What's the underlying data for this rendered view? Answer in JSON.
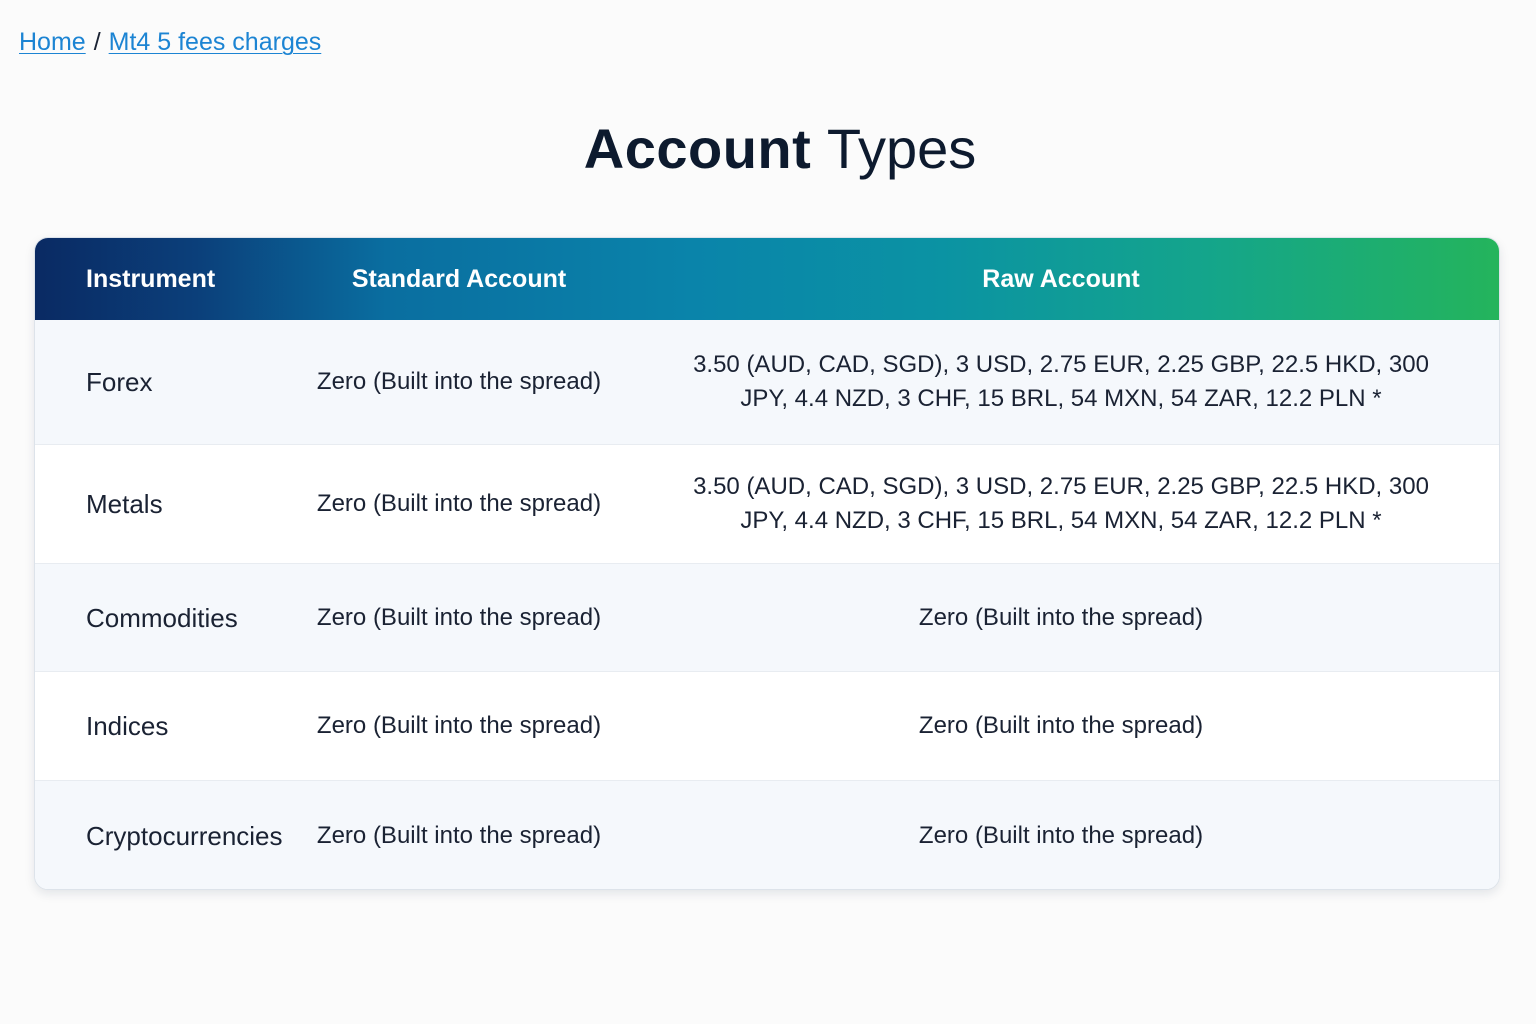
{
  "breadcrumb": {
    "home": "Home",
    "separator": "/",
    "current": "Mt4 5 fees charges"
  },
  "page": {
    "title_strong": "Account",
    "title_light": "Types"
  },
  "table": {
    "headers": [
      "Instrument",
      "Standard Account",
      "Raw Account"
    ],
    "rows": [
      {
        "instrument": "Forex",
        "standard": "Zero (Built into the spread)",
        "raw": "3.50 (AUD, CAD, SGD), 3 USD, 2.75 EUR, 2.25 GBP, 22.5 HKD, 300 JPY, 4.4 NZD, 3 CHF, 15 BRL, 54 MXN, 54 ZAR, 12.2 PLN *"
      },
      {
        "instrument": "Metals",
        "standard": "Zero (Built into the spread)",
        "raw": "3.50 (AUD, CAD, SGD), 3 USD, 2.75 EUR, 2.25 GBP, 22.5 HKD, 300 JPY, 4.4 NZD, 3 CHF, 15 BRL, 54 MXN, 54 ZAR, 12.2 PLN *"
      },
      {
        "instrument": "Commodities",
        "standard": "Zero (Built into the spread)",
        "raw": "Zero (Built into the spread)"
      },
      {
        "instrument": "Indices",
        "standard": "Zero (Built into the spread)",
        "raw": "Zero (Built into the spread)"
      },
      {
        "instrument": "Cryptocurrencies",
        "standard": "Zero (Built into the spread)",
        "raw": "Zero (Built into the spread)"
      }
    ]
  },
  "colors": {
    "link": "#1c84d3",
    "header_gradient_start": "#0a2a63",
    "header_gradient_mid": "#0a84aa",
    "header_gradient_end": "#24b45c",
    "row_alt": "#f5f8fc"
  }
}
